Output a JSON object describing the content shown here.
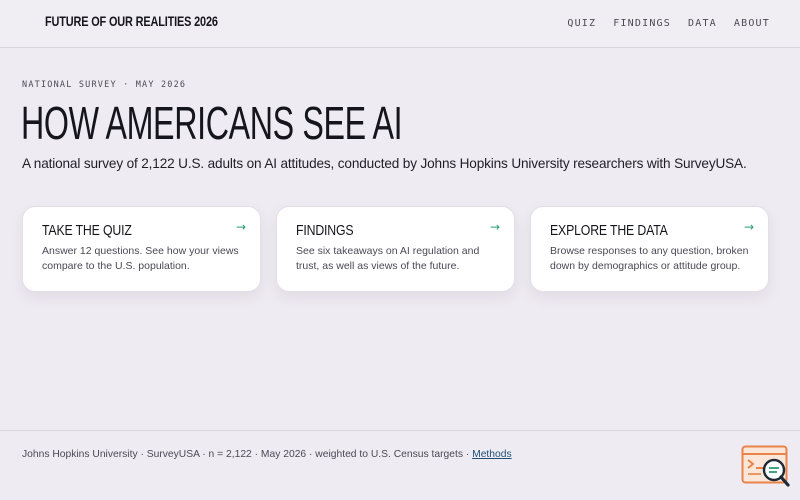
{
  "header": {
    "brand": "FUTURE OF OUR REALITIES 2026",
    "nav": [
      "QUIZ",
      "FINDINGS",
      "DATA",
      "ABOUT"
    ]
  },
  "hero": {
    "eyebrow": "NATIONAL SURVEY · MAY 2026",
    "title": "HOW AMERICANS SEE AI",
    "subtitle": "A national survey of 2,122 U.S. adults on AI attitudes, conducted by Johns Hopkins University researchers with SurveyUSA."
  },
  "cards": [
    {
      "title": "TAKE THE QUIZ",
      "description": "Answer 12 questions. See how your views compare to the U.S. population.",
      "arrow": "→"
    },
    {
      "title": "FINDINGS",
      "description": "See six takeaways on AI regulation and trust, as well as views of the future.",
      "arrow": "→"
    },
    {
      "title": "EXPLORE THE DATA",
      "description": "Browse responses to any question, broken down by demographics or attitude group.",
      "arrow": "→"
    }
  ],
  "footer": {
    "text": "Johns Hopkins University · SurveyUSA · n = 2,122 · May 2026 · weighted to U.S. Census targets · ",
    "methods_link": "Methods"
  },
  "colors": {
    "background": "#efebf2",
    "accent_arrow": "#2e9b75",
    "link": "#1f4f78",
    "corner_icon": "#e8834a"
  },
  "icons": {
    "corner": "terminal-search-icon",
    "card_arrow": "arrow-right-icon"
  }
}
